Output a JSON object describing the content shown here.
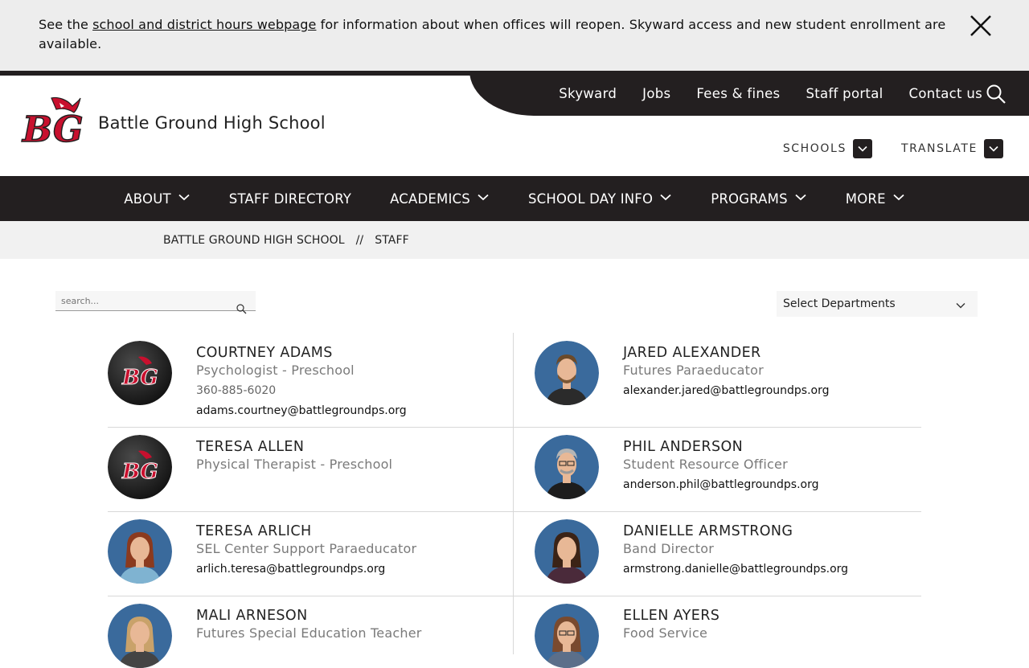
{
  "alert": {
    "text_before": "See the ",
    "link_text": "school and district hours webpage",
    "text_after": " for information about when offices will reopen. Skyward access and new student enrollment are available."
  },
  "header": {
    "school_name": "Battle Ground High School",
    "logo_text": "BG",
    "utility_links": [
      "Skyward",
      "Jobs",
      "Fees & fines",
      "Staff portal",
      "Contact us"
    ],
    "schools_label": "SCHOOLS",
    "translate_label": "TRANSLATE"
  },
  "nav": [
    {
      "label": "ABOUT",
      "dropdown": true
    },
    {
      "label": "STAFF DIRECTORY",
      "dropdown": false
    },
    {
      "label": "ACADEMICS",
      "dropdown": true
    },
    {
      "label": "SCHOOL DAY INFO",
      "dropdown": true
    },
    {
      "label": "PROGRAMS",
      "dropdown": true
    },
    {
      "label": "MORE",
      "dropdown": true
    }
  ],
  "breadcrumb": {
    "items": [
      "BATTLE GROUND HIGH SCHOOL",
      "STAFF"
    ],
    "separator": "//"
  },
  "filters": {
    "search_placeholder": "search...",
    "department_label": "Select Departments"
  },
  "colors": {
    "dark": "#231f20",
    "alert_bg": "#ededed",
    "brand_red": "#c8102e"
  },
  "staff": [
    {
      "name": "COURTNEY ADAMS",
      "title": "Psychologist - Preschool",
      "phone": "360-885-6020",
      "email": "adams.courtney@battlegroundps.org",
      "photo": "logo"
    },
    {
      "name": "JARED ALEXANDER",
      "title": "Futures Paraeducator",
      "phone": "",
      "email": "alexander.jared@battlegroundps.org",
      "photo": "man-beard"
    },
    {
      "name": "TERESA ALLEN",
      "title": "Physical Therapist - Preschool",
      "phone": "",
      "email": "",
      "photo": "logo"
    },
    {
      "name": "PHIL ANDERSON",
      "title": "Student Resource Officer",
      "phone": "",
      "email": "anderson.phil@battlegroundps.org",
      "photo": "man-glasses"
    },
    {
      "name": "TERESA ARLICH",
      "title": "SEL Center Support Paraeducator",
      "phone": "",
      "email": "arlich.teresa@battlegroundps.org",
      "photo": "woman-red"
    },
    {
      "name": "DANIELLE ARMSTRONG",
      "title": "Band Director",
      "phone": "",
      "email": "armstrong.danielle@battlegroundps.org",
      "photo": "woman-dark"
    },
    {
      "name": "MALI ARNESON",
      "title": "Futures Special Education Teacher",
      "phone": "",
      "email": "",
      "photo": "woman-blonde"
    },
    {
      "name": "ELLEN AYERS",
      "title": "Food Service",
      "phone": "",
      "email": "",
      "photo": "woman-glasses"
    }
  ]
}
